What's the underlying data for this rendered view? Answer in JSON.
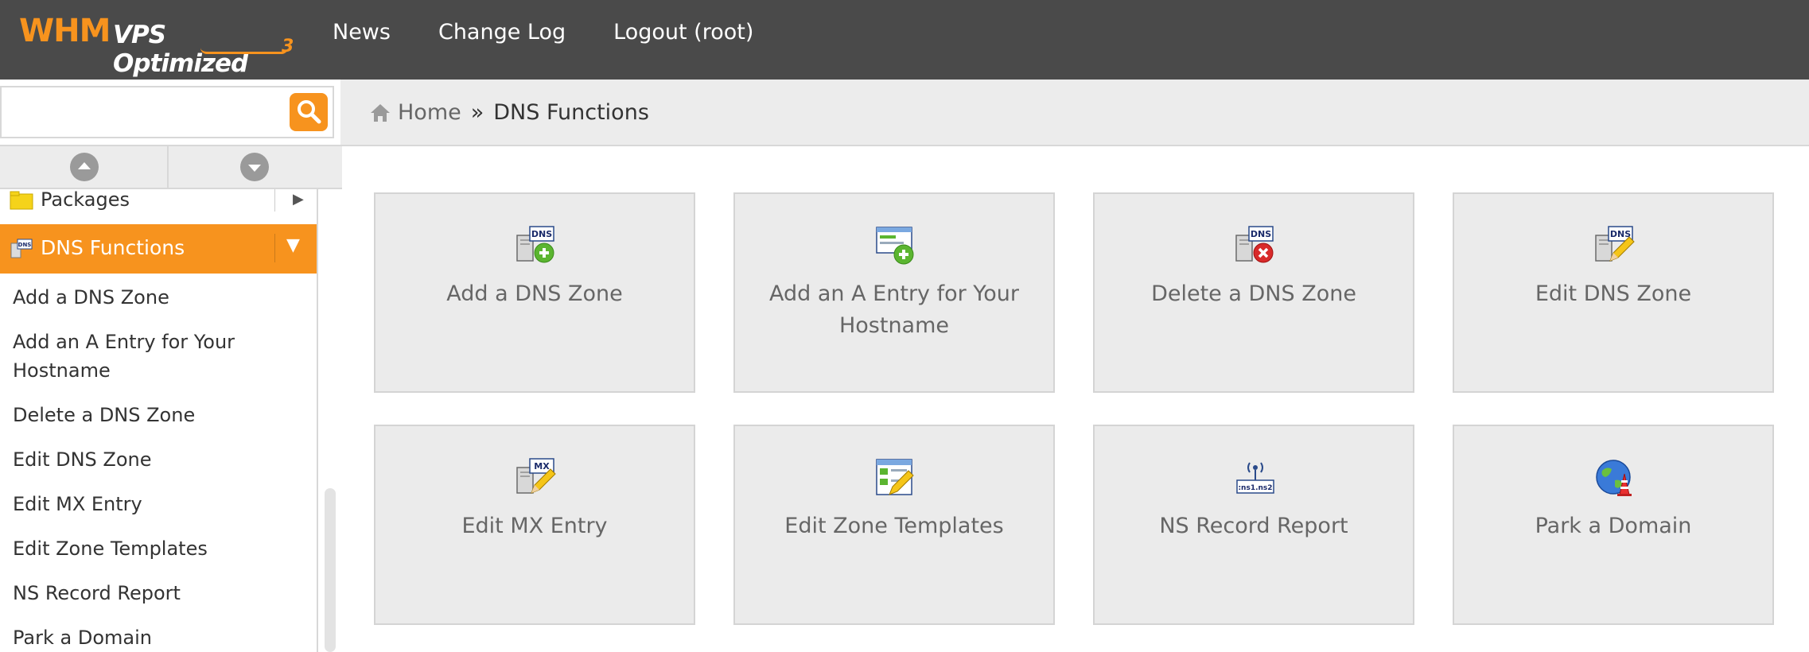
{
  "app": {
    "logo_text": "WHM",
    "logo_subtext": "VPS Optimized",
    "logo_version": "3"
  },
  "topnav": {
    "items": [
      {
        "label": "News"
      },
      {
        "label": "Change Log"
      },
      {
        "label": "Logout (root)"
      }
    ]
  },
  "search": {
    "value": "",
    "placeholder": ""
  },
  "breadcrumb": {
    "home": "Home",
    "separator": "»",
    "current": "DNS Functions"
  },
  "sidebar": {
    "prev_section": "Packages",
    "active_section": "DNS Functions",
    "items": [
      {
        "label": "Add a DNS Zone"
      },
      {
        "label": "Add an A Entry for Your Hostname"
      },
      {
        "label": "Delete a DNS Zone"
      },
      {
        "label": "Edit DNS Zone"
      },
      {
        "label": "Edit MX Entry"
      },
      {
        "label": "Edit Zone Templates"
      },
      {
        "label": "NS Record Report"
      },
      {
        "label": "Park a Domain"
      }
    ]
  },
  "tiles": [
    {
      "label": "Add a DNS Zone",
      "icon": "dns-add-icon"
    },
    {
      "label": "Add an A Entry for Your Hostname",
      "icon": "a-entry-add-icon"
    },
    {
      "label": "Delete a DNS Zone",
      "icon": "dns-delete-icon"
    },
    {
      "label": "Edit DNS Zone",
      "icon": "dns-edit-icon"
    },
    {
      "label": "Edit MX Entry",
      "icon": "mx-edit-icon"
    },
    {
      "label": "Edit Zone Templates",
      "icon": "zone-templates-icon"
    },
    {
      "label": "NS Record Report",
      "icon": "ns-report-icon"
    },
    {
      "label": "Park a Domain",
      "icon": "park-domain-icon"
    }
  ],
  "colors": {
    "topbar": "#4a4a4a",
    "accent": "#f7931e",
    "tile_bg": "#ebebeb",
    "tile_text": "#666666"
  }
}
